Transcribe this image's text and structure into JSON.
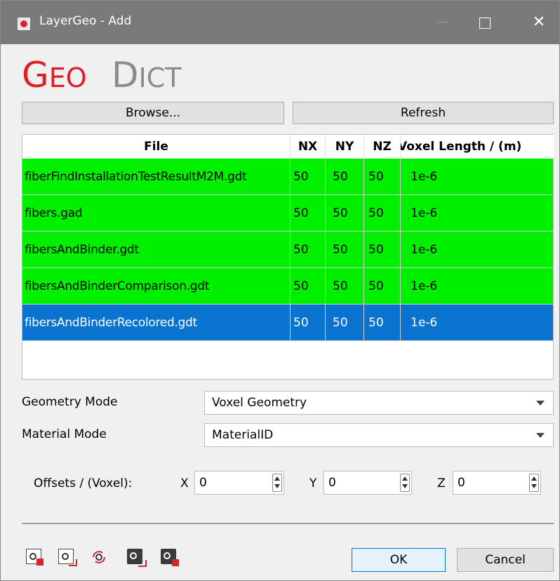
{
  "window": {
    "title": "LayerGeo - Add",
    "close_glyph": "✕"
  },
  "logo": {
    "geo_first": "G",
    "geo_rest": "EO",
    "dict_first": "D",
    "dict_rest": "ICT",
    "brand_red": "#e01e26",
    "brand_gray": "#8c8c8c"
  },
  "toolbar": {
    "browse_label": "Browse...",
    "refresh_label": "Refresh"
  },
  "table": {
    "headers": {
      "file": "File",
      "nx": "NX",
      "ny": "NY",
      "nz": "NZ",
      "voxel_length": "Voxel Length / (m)"
    },
    "rows": [
      {
        "file": "fiberFindInstallationTestResultM2M.gdt",
        "nx": "50",
        "ny": "50",
        "nz": "50",
        "voxel_length": "1e-6"
      },
      {
        "file": "fibers.gad",
        "nx": "50",
        "ny": "50",
        "nz": "50",
        "voxel_length": "1e-6"
      },
      {
        "file": "fibersAndBinder.gdt",
        "nx": "50",
        "ny": "50",
        "nz": "50",
        "voxel_length": "1e-6"
      },
      {
        "file": "fibersAndBinderComparison.gdt",
        "nx": "50",
        "ny": "50",
        "nz": "50",
        "voxel_length": "1e-6"
      },
      {
        "file": "fibersAndBinderRecolored.gdt",
        "nx": "50",
        "ny": "50",
        "nz": "50",
        "voxel_length": "1e-6"
      }
    ],
    "selected_row": 4,
    "row_color": "#00f000",
    "selected_color": "#0a73d0"
  },
  "form": {
    "geometry_mode_label": "Geometry Mode",
    "geometry_mode_value": "Voxel Geometry",
    "material_mode_label": "Material Mode",
    "material_mode_value": "MaterialID",
    "offsets_label": "Offsets / (Voxel):",
    "x_label": "X",
    "x_value": "0",
    "y_label": "Y",
    "y_value": "0",
    "z_label": "Z",
    "z_value": "0"
  },
  "footer": {
    "icons": [
      "add-document-icon",
      "export-document-icon",
      "rotate-gear-icon",
      "save-geometry-icon",
      "delete-geometry-icon"
    ],
    "ok_label": "OK",
    "cancel_label": "Cancel"
  }
}
